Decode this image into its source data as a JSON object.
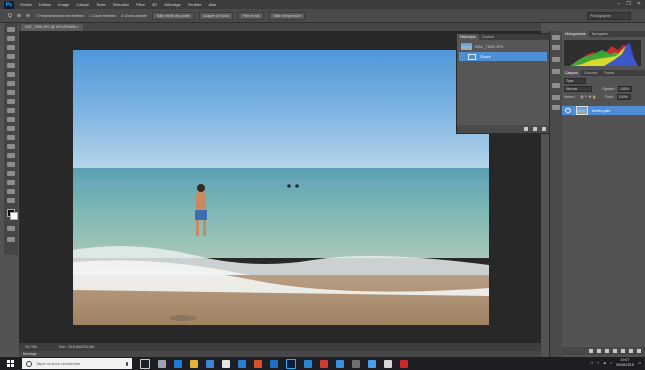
{
  "app": {
    "logo_text": "Ps"
  },
  "menu": [
    "Fichier",
    "Edition",
    "Image",
    "Calque",
    "Texte",
    "Sélection",
    "Filtre",
    "3D",
    "Affichage",
    "Fenêtre",
    "Aide"
  ],
  "window_controls": [
    "–",
    "❐",
    "✕"
  ],
  "options_bar": {
    "tool_glyph": "Q",
    "items": [
      "Redimensionner les fenêtres",
      "Zoom fenêtres",
      "Zoom variable"
    ],
    "buttons": [
      "Taille réelle des pixels",
      "Adapter à l'écran",
      "Plein écran",
      "Taille d'impression"
    ],
    "workspace": "Photographie"
  },
  "document": {
    "tab_title": "DSC_7005.JPG @ 16% (RVB/8)",
    "tab_close": "×"
  },
  "status_bar": {
    "zoom": "15,74%",
    "doc_size": "Doc : 23,6 Mo/23,6 Mo"
  },
  "timeline_tab": "Montage",
  "history_panel": {
    "tabs": [
      "Historique",
      "Couleur"
    ],
    "snapshot_label": "DSC_7005.JPG",
    "state_label": "Ouvrir"
  },
  "right_dock": {
    "top_tabs": [
      "Histogramme",
      "Navigation"
    ],
    "layer_tabs": [
      "Calques",
      "Couches",
      "Tracés"
    ],
    "kind_filter": "Type",
    "blend_mode": "Normal",
    "opacity_label": "Opacité :",
    "opacity": "100%",
    "lock_label": "Verrou :",
    "fill_label": "Fond :",
    "fill": "100%",
    "layer_name": "Arrière-plan"
  },
  "taskbar": {
    "search_placeholder": "Taper ici pour rechercher",
    "time": "19:07",
    "date": "05/08/2018"
  }
}
